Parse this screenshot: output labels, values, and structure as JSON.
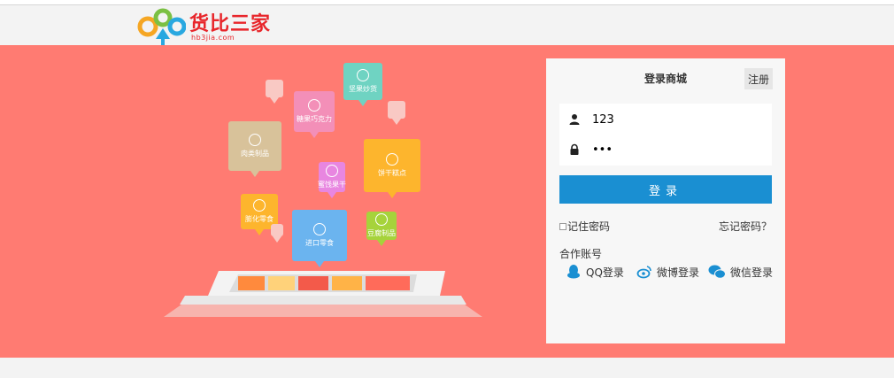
{
  "header": {
    "logo_name": "货比三家",
    "logo_url": "hb3jia.com"
  },
  "illustration": {
    "bubbles": [
      {
        "label": "坚果炒货",
        "color": "#6fd3c2"
      },
      {
        "label": "糖果巧克力",
        "color": "#f38fb8"
      },
      {
        "label": "肉类制品",
        "color": "#d8c29a"
      },
      {
        "label": "饼干糕点",
        "color": "#fdb52d"
      },
      {
        "label": "膨化零食",
        "color": "#fdb52d"
      },
      {
        "label": "蜜饯果干",
        "color": "#e886e0"
      },
      {
        "label": "进口零食",
        "color": "#6bb4ef"
      },
      {
        "label": "豆腐制品",
        "color": "#a6d33b"
      }
    ]
  },
  "login": {
    "title": "登录商城",
    "register_label": "注册",
    "username_value": "123",
    "password_value": "•••",
    "submit_label": "登录",
    "remember_label": "记住密码",
    "forgot_label": "忘记密码？",
    "partner_title": "合作账号",
    "qq_label": "QQ登录",
    "weibo_label": "微博登录",
    "wechat_label": "微信登录"
  },
  "colors": {
    "banner": "#ff7b72",
    "accent": "#1a8fd2",
    "brand": "#e8262b"
  }
}
